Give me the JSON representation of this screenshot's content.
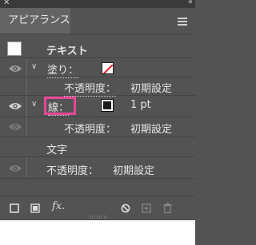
{
  "window": {
    "close_glyph": "✕",
    "collapse_glyph": "«"
  },
  "panel": {
    "tab_title": "アピアランス",
    "menu_icon": "hamburger-menu-icon"
  },
  "object": {
    "label": "テキスト"
  },
  "fill": {
    "label": "塗り：",
    "swatch": "none",
    "opacity_label": "不透明度：",
    "opacity_value": "初期設定"
  },
  "stroke": {
    "label": "線：",
    "swatch_color": "#000000",
    "weight": "1 pt",
    "opacity_label": "不透明度：",
    "opacity_value": "初期設定"
  },
  "characters": {
    "label": "文字"
  },
  "text_opacity": {
    "label": "不透明度：",
    "value": "初期設定"
  },
  "bottom_toolbar": {
    "fx_label": "fx.",
    "icons": [
      "add-stroke-icon",
      "add-fill-icon",
      "add-effect-icon",
      "clear-appearance-icon",
      "duplicate-item-icon",
      "delete-item-icon"
    ]
  },
  "colors": {
    "panel_bg": "#535353",
    "highlight": "#e9479a"
  }
}
